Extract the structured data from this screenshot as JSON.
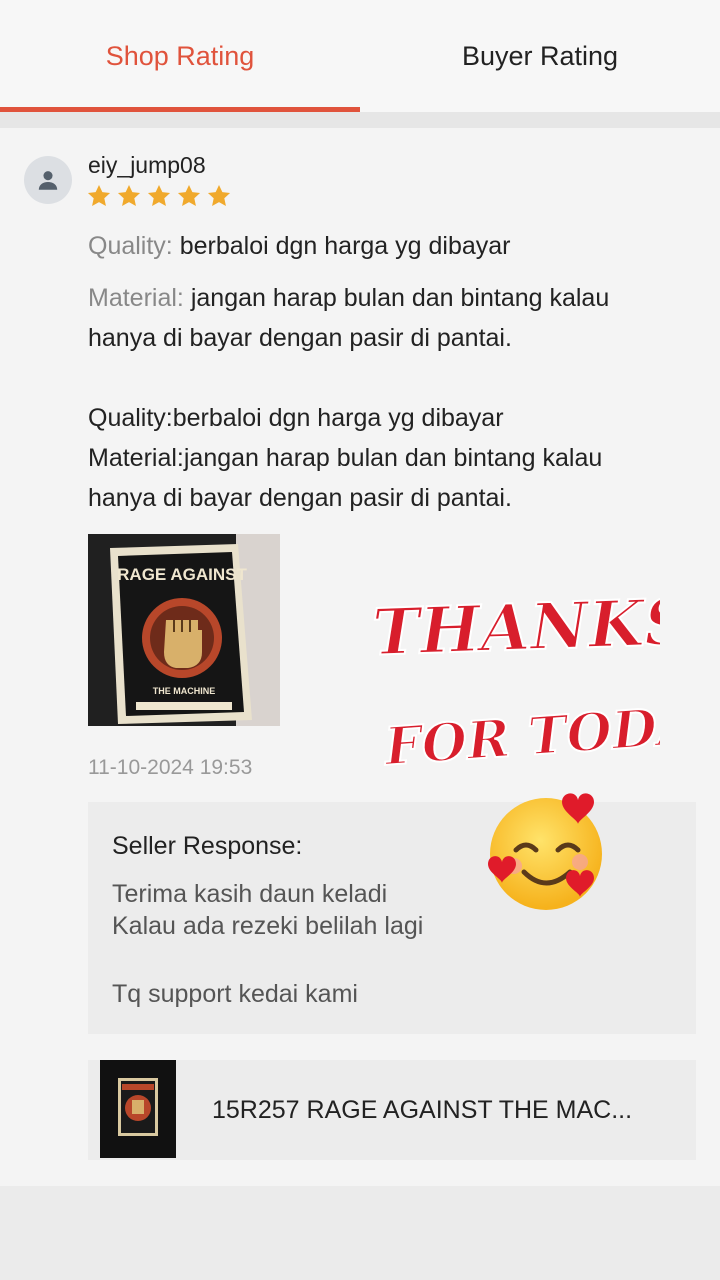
{
  "tabs": {
    "shop_rating": "Shop Rating",
    "buyer_rating": "Buyer Rating"
  },
  "review": {
    "username": "eiy_jump08",
    "rating": 5,
    "quality_label": "Quality:",
    "quality_value": "berbaloi dgn harga yg dibayar",
    "material_label": "Material:",
    "material_value_line1": "jangan harap bulan dan bintang kalau",
    "material_value_line2": "hanya di bayar dengan pasir di pantai.",
    "body_line1": "Quality:berbaloi dgn harga yg dibayar",
    "body_line2": "Material:jangan harap bulan dan bintang kalau",
    "body_line3": "hanya di bayar dengan pasir di pantai.",
    "image_text_top": "RAGE AGAINST",
    "image_text_bottom": "THE MACHINE",
    "date": "11-10-2024 19:53"
  },
  "sticker": {
    "line1": "THANKS",
    "line2": "FOR TODAY"
  },
  "seller_response": {
    "title": "Seller Response:",
    "line1": "Terima kasih daun keladi",
    "line2": "Kalau ada rezeki belilah lagi",
    "line3": "Tq support kedai kami"
  },
  "product": {
    "name": "15R257 RAGE AGAINST THE MAC..."
  },
  "colors": {
    "accent": "#e0533c",
    "star": "#f5a623",
    "sticker_red": "#d81e2c"
  }
}
